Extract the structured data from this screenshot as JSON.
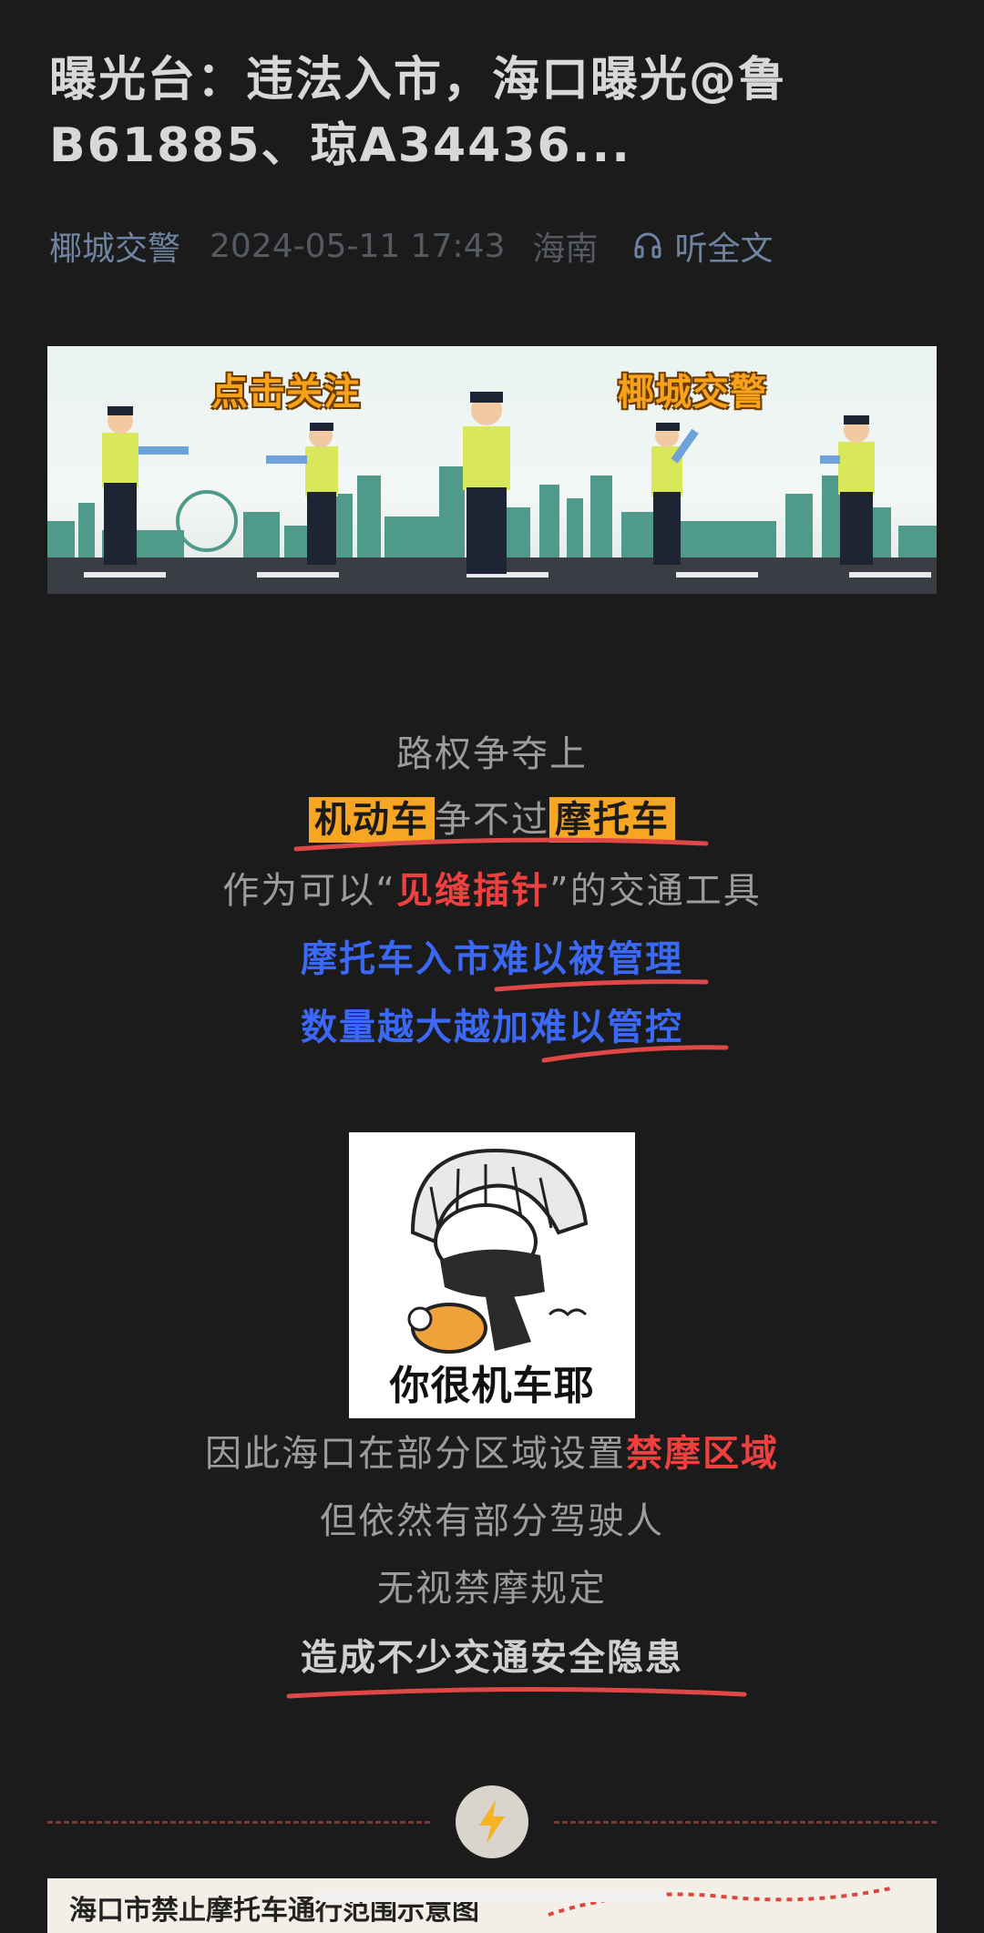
{
  "article": {
    "title": "曝光台：违法入市，海口曝光@鲁B61885、琼A34436...",
    "author": "椰城交警",
    "date": "2024-05-11 17:43",
    "location": "海南",
    "listen_label": "听全文"
  },
  "banner": {
    "left_tag": "点击关注",
    "right_tag": "椰城交警"
  },
  "body": {
    "l1": "路权争夺上",
    "l2_a": "机动车",
    "l2_b": "争不过",
    "l2_c": "摩托车",
    "l3_a": "作为可以“",
    "l3_b": "见缝插针",
    "l3_c": "”的交通工具",
    "l4": "摩托车入市难以被管理",
    "l5": "数量越大越加难以管控",
    "meme_caption": "你很机车耶",
    "l6_a": "因此海口在部分区域设置",
    "l6_b": "禁摩区域",
    "l7": "但依然有部分驾驶人",
    "l8": "无视禁摩规定",
    "l9": "造成不少交通安全隐患"
  },
  "map": {
    "title": "海口市禁止摩托车通行范围示意图"
  },
  "colors": {
    "background": "#1b1b1b",
    "highlight": "#f6a623",
    "red": "#ef3f3f",
    "blue": "#3b68f5",
    "underline": "#e04848"
  }
}
